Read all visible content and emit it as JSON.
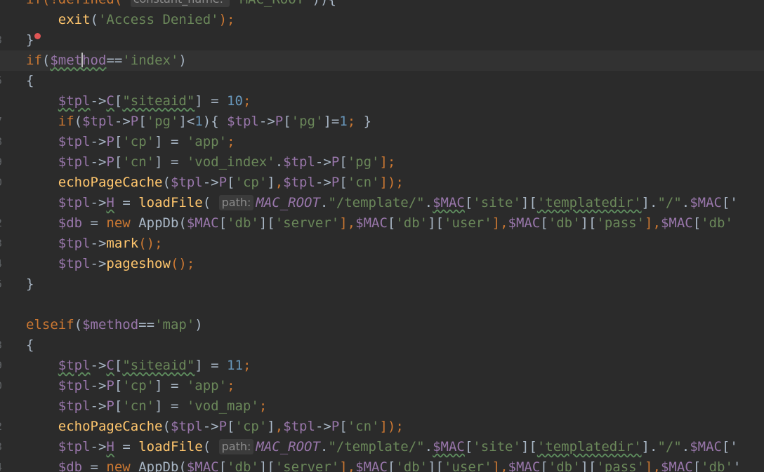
{
  "editor": {
    "line_numbers": [
      "",
      "",
      "3",
      "",
      "5",
      "",
      "7",
      "8",
      "9",
      "0",
      "",
      "2",
      "3",
      "4",
      "5",
      "",
      "",
      "3",
      "9",
      "0",
      "",
      "2",
      "3",
      "4",
      "5"
    ],
    "lines": [
      {
        "tokens": [
          {
            "t": "if(!defined( ",
            "c": "kw"
          },
          {
            "t": "constant_name: ",
            "c": "hint"
          },
          {
            "t": "'MAC_ROOT'",
            "c": "str"
          },
          {
            "t": ")){",
            "c": "op"
          }
        ]
      },
      {
        "tokens": [
          {
            "t": "    ",
            "c": ""
          },
          {
            "t": "exit",
            "c": "fn"
          },
          {
            "t": "(",
            "c": "op"
          },
          {
            "t": "'Access Denied'",
            "c": "str"
          },
          {
            "t": ");",
            "c": "kw"
          }
        ]
      },
      {
        "tokens": [
          {
            "t": "}",
            "c": "op"
          },
          {
            "t": "",
            "c": "bulb"
          }
        ]
      },
      {
        "current": true,
        "tokens": [
          {
            "t": "if",
            "c": "kw"
          },
          {
            "t": "(",
            "c": "op"
          },
          {
            "t": "$met",
            "c": "var sq"
          },
          {
            "t": "",
            "c": "caret"
          },
          {
            "t": "hod",
            "c": "var sq"
          },
          {
            "t": "==",
            "c": "op"
          },
          {
            "t": "'index'",
            "c": "str"
          },
          {
            "t": ")",
            "c": "op"
          }
        ]
      },
      {
        "tokens": [
          {
            "t": "{",
            "c": "op"
          }
        ]
      },
      {
        "tokens": [
          {
            "t": "    ",
            "c": ""
          },
          {
            "t": "$tpl",
            "c": "var sq"
          },
          {
            "t": "->",
            "c": "op"
          },
          {
            "t": "C",
            "c": "prop sq"
          },
          {
            "t": "[",
            "c": "op"
          },
          {
            "t": "\"siteaid\"",
            "c": "str sq"
          },
          {
            "t": "] = ",
            "c": "op"
          },
          {
            "t": "10",
            "c": "num"
          },
          {
            "t": ";",
            "c": "kw"
          }
        ]
      },
      {
        "tokens": [
          {
            "t": "    ",
            "c": ""
          },
          {
            "t": "if",
            "c": "kw"
          },
          {
            "t": "(",
            "c": "op"
          },
          {
            "t": "$tpl",
            "c": "var"
          },
          {
            "t": "->",
            "c": "op"
          },
          {
            "t": "P",
            "c": "prop"
          },
          {
            "t": "[",
            "c": "op"
          },
          {
            "t": "'pg'",
            "c": "str"
          },
          {
            "t": "]<",
            "c": "op"
          },
          {
            "t": "1",
            "c": "num"
          },
          {
            "t": "){ ",
            "c": "op"
          },
          {
            "t": "$tpl",
            "c": "var"
          },
          {
            "t": "->",
            "c": "op"
          },
          {
            "t": "P",
            "c": "prop"
          },
          {
            "t": "[",
            "c": "op"
          },
          {
            "t": "'pg'",
            "c": "str"
          },
          {
            "t": "]=",
            "c": "op"
          },
          {
            "t": "1",
            "c": "num"
          },
          {
            "t": "; ",
            "c": "kw"
          },
          {
            "t": "}",
            "c": "op"
          }
        ]
      },
      {
        "tokens": [
          {
            "t": "    ",
            "c": ""
          },
          {
            "t": "$tpl",
            "c": "var"
          },
          {
            "t": "->",
            "c": "op"
          },
          {
            "t": "P",
            "c": "prop"
          },
          {
            "t": "[",
            "c": "op"
          },
          {
            "t": "'cp'",
            "c": "str"
          },
          {
            "t": "] = ",
            "c": "op"
          },
          {
            "t": "'app'",
            "c": "str"
          },
          {
            "t": ";",
            "c": "kw"
          }
        ]
      },
      {
        "tokens": [
          {
            "t": "    ",
            "c": ""
          },
          {
            "t": "$tpl",
            "c": "var"
          },
          {
            "t": "->",
            "c": "op"
          },
          {
            "t": "P",
            "c": "prop"
          },
          {
            "t": "[",
            "c": "op"
          },
          {
            "t": "'cn'",
            "c": "str"
          },
          {
            "t": "] = ",
            "c": "op"
          },
          {
            "t": "'vod_index'",
            "c": "str"
          },
          {
            "t": ".",
            "c": "op"
          },
          {
            "t": "$tpl",
            "c": "var"
          },
          {
            "t": "->",
            "c": "op"
          },
          {
            "t": "P",
            "c": "prop"
          },
          {
            "t": "[",
            "c": "op"
          },
          {
            "t": "'pg'",
            "c": "str"
          },
          {
            "t": "];",
            "c": "kw"
          }
        ]
      },
      {
        "tokens": [
          {
            "t": "    ",
            "c": ""
          },
          {
            "t": "echoPageCache",
            "c": "fn"
          },
          {
            "t": "(",
            "c": "op"
          },
          {
            "t": "$tpl",
            "c": "var"
          },
          {
            "t": "->",
            "c": "op"
          },
          {
            "t": "P",
            "c": "prop"
          },
          {
            "t": "[",
            "c": "op"
          },
          {
            "t": "'cp'",
            "c": "str"
          },
          {
            "t": "]",
            "c": "op"
          },
          {
            "t": ",",
            "c": "kw"
          },
          {
            "t": "$tpl",
            "c": "var"
          },
          {
            "t": "->",
            "c": "op"
          },
          {
            "t": "P",
            "c": "prop"
          },
          {
            "t": "[",
            "c": "op"
          },
          {
            "t": "'cn'",
            "c": "str"
          },
          {
            "t": "]);",
            "c": "kw"
          }
        ]
      },
      {
        "tokens": [
          {
            "t": "    ",
            "c": ""
          },
          {
            "t": "$tpl",
            "c": "var"
          },
          {
            "t": "->",
            "c": "op"
          },
          {
            "t": "H",
            "c": "prop sq"
          },
          {
            "t": " = ",
            "c": "op"
          },
          {
            "t": "loadFile",
            "c": "fn"
          },
          {
            "t": "( ",
            "c": "op"
          },
          {
            "t": "path:",
            "c": "hint"
          },
          {
            "t": "MAC_ROOT",
            "c": "const"
          },
          {
            "t": ".",
            "c": "op"
          },
          {
            "t": "\"/template/\"",
            "c": "str"
          },
          {
            "t": ".",
            "c": "op"
          },
          {
            "t": "$MAC",
            "c": "var sq"
          },
          {
            "t": "[",
            "c": "op"
          },
          {
            "t": "'site'",
            "c": "str"
          },
          {
            "t": "][",
            "c": "op"
          },
          {
            "t": "'templatedir'",
            "c": "str sq"
          },
          {
            "t": "].",
            "c": "op"
          },
          {
            "t": "\"/\"",
            "c": "str"
          },
          {
            "t": ".",
            "c": "op"
          },
          {
            "t": "$MAC",
            "c": "var"
          },
          {
            "t": "['",
            "c": "op"
          }
        ]
      },
      {
        "tokens": [
          {
            "t": "    ",
            "c": ""
          },
          {
            "t": "$db",
            "c": "var"
          },
          {
            "t": " = ",
            "c": "op"
          },
          {
            "t": "new ",
            "c": "kw"
          },
          {
            "t": "AppDb",
            "c": "cls"
          },
          {
            "t": "(",
            "c": "op"
          },
          {
            "t": "$MAC",
            "c": "var"
          },
          {
            "t": "[",
            "c": "op"
          },
          {
            "t": "'db'",
            "c": "str"
          },
          {
            "t": "][",
            "c": "op"
          },
          {
            "t": "'server'",
            "c": "str"
          },
          {
            "t": "],",
            "c": "kw"
          },
          {
            "t": "$MAC",
            "c": "var"
          },
          {
            "t": "[",
            "c": "op"
          },
          {
            "t": "'db'",
            "c": "str"
          },
          {
            "t": "][",
            "c": "op"
          },
          {
            "t": "'user'",
            "c": "str"
          },
          {
            "t": "],",
            "c": "kw"
          },
          {
            "t": "$MAC",
            "c": "var"
          },
          {
            "t": "[",
            "c": "op"
          },
          {
            "t": "'db'",
            "c": "str"
          },
          {
            "t": "][",
            "c": "op"
          },
          {
            "t": "'pass'",
            "c": "str"
          },
          {
            "t": "],",
            "c": "kw"
          },
          {
            "t": "$MAC",
            "c": "var"
          },
          {
            "t": "[",
            "c": "op"
          },
          {
            "t": "'db'",
            "c": "str"
          }
        ]
      },
      {
        "tokens": [
          {
            "t": "    ",
            "c": ""
          },
          {
            "t": "$tpl",
            "c": "var"
          },
          {
            "t": "->",
            "c": "op"
          },
          {
            "t": "mark",
            "c": "fn"
          },
          {
            "t": "();",
            "c": "kw"
          }
        ]
      },
      {
        "tokens": [
          {
            "t": "    ",
            "c": ""
          },
          {
            "t": "$tpl",
            "c": "var"
          },
          {
            "t": "->",
            "c": "op"
          },
          {
            "t": "pageshow",
            "c": "fn"
          },
          {
            "t": "();",
            "c": "kw"
          }
        ]
      },
      {
        "tokens": [
          {
            "t": "}",
            "c": "op"
          }
        ]
      },
      {
        "tokens": []
      },
      {
        "tokens": [
          {
            "t": "elseif",
            "c": "kw"
          },
          {
            "t": "(",
            "c": "op"
          },
          {
            "t": "$method",
            "c": "var"
          },
          {
            "t": "==",
            "c": "op"
          },
          {
            "t": "'map'",
            "c": "str"
          },
          {
            "t": ")",
            "c": "op"
          }
        ]
      },
      {
        "tokens": [
          {
            "t": "{",
            "c": "op"
          }
        ]
      },
      {
        "tokens": [
          {
            "t": "    ",
            "c": ""
          },
          {
            "t": "$tpl",
            "c": "var sq"
          },
          {
            "t": "->",
            "c": "op"
          },
          {
            "t": "C",
            "c": "prop sq"
          },
          {
            "t": "[",
            "c": "op"
          },
          {
            "t": "\"siteaid\"",
            "c": "str sq"
          },
          {
            "t": "] = ",
            "c": "op"
          },
          {
            "t": "11",
            "c": "num"
          },
          {
            "t": ";",
            "c": "kw"
          }
        ]
      },
      {
        "tokens": [
          {
            "t": "    ",
            "c": ""
          },
          {
            "t": "$tpl",
            "c": "var"
          },
          {
            "t": "->",
            "c": "op"
          },
          {
            "t": "P",
            "c": "prop"
          },
          {
            "t": "[",
            "c": "op"
          },
          {
            "t": "'cp'",
            "c": "str"
          },
          {
            "t": "] = ",
            "c": "op"
          },
          {
            "t": "'app'",
            "c": "str"
          },
          {
            "t": ";",
            "c": "kw"
          }
        ]
      },
      {
        "tokens": [
          {
            "t": "    ",
            "c": ""
          },
          {
            "t": "$tpl",
            "c": "var"
          },
          {
            "t": "->",
            "c": "op"
          },
          {
            "t": "P",
            "c": "prop"
          },
          {
            "t": "[",
            "c": "op"
          },
          {
            "t": "'cn'",
            "c": "str"
          },
          {
            "t": "] = ",
            "c": "op"
          },
          {
            "t": "'vod_map'",
            "c": "str"
          },
          {
            "t": ";",
            "c": "kw"
          }
        ]
      },
      {
        "tokens": [
          {
            "t": "    ",
            "c": ""
          },
          {
            "t": "echoPageCache",
            "c": "fn"
          },
          {
            "t": "(",
            "c": "op"
          },
          {
            "t": "$tpl",
            "c": "var"
          },
          {
            "t": "->",
            "c": "op"
          },
          {
            "t": "P",
            "c": "prop"
          },
          {
            "t": "[",
            "c": "op"
          },
          {
            "t": "'cp'",
            "c": "str"
          },
          {
            "t": "]",
            "c": "op"
          },
          {
            "t": ",",
            "c": "kw"
          },
          {
            "t": "$tpl",
            "c": "var"
          },
          {
            "t": "->",
            "c": "op"
          },
          {
            "t": "P",
            "c": "prop"
          },
          {
            "t": "[",
            "c": "op"
          },
          {
            "t": "'cn'",
            "c": "str"
          },
          {
            "t": "]);",
            "c": "kw"
          }
        ]
      },
      {
        "tokens": [
          {
            "t": "    ",
            "c": ""
          },
          {
            "t": "$tpl",
            "c": "var"
          },
          {
            "t": "->",
            "c": "op"
          },
          {
            "t": "H",
            "c": "prop sq"
          },
          {
            "t": " = ",
            "c": "op"
          },
          {
            "t": "loadFile",
            "c": "fn"
          },
          {
            "t": "( ",
            "c": "op"
          },
          {
            "t": "path:",
            "c": "hint"
          },
          {
            "t": "MAC_ROOT",
            "c": "const"
          },
          {
            "t": ".",
            "c": "op"
          },
          {
            "t": "\"/template/\"",
            "c": "str"
          },
          {
            "t": ".",
            "c": "op"
          },
          {
            "t": "$MAC",
            "c": "var sq"
          },
          {
            "t": "[",
            "c": "op"
          },
          {
            "t": "'site'",
            "c": "str"
          },
          {
            "t": "][",
            "c": "op"
          },
          {
            "t": "'templatedir'",
            "c": "str sq"
          },
          {
            "t": "].",
            "c": "op"
          },
          {
            "t": "\"/\"",
            "c": "str"
          },
          {
            "t": ".",
            "c": "op"
          },
          {
            "t": "$MAC",
            "c": "var"
          },
          {
            "t": "['",
            "c": "op"
          }
        ]
      },
      {
        "tokens": [
          {
            "t": "    ",
            "c": ""
          },
          {
            "t": "$db",
            "c": "var"
          },
          {
            "t": " = ",
            "c": "op"
          },
          {
            "t": "new ",
            "c": "kw"
          },
          {
            "t": "AppDb",
            "c": "cls"
          },
          {
            "t": "(",
            "c": "op"
          },
          {
            "t": "$MAC",
            "c": "var"
          },
          {
            "t": "[",
            "c": "op"
          },
          {
            "t": "'db'",
            "c": "str"
          },
          {
            "t": "][",
            "c": "op"
          },
          {
            "t": "'server'",
            "c": "str"
          },
          {
            "t": "],",
            "c": "kw"
          },
          {
            "t": "$MAC",
            "c": "var"
          },
          {
            "t": "[",
            "c": "op"
          },
          {
            "t": "'db'",
            "c": "str"
          },
          {
            "t": "][",
            "c": "op"
          },
          {
            "t": "'user'",
            "c": "str"
          },
          {
            "t": "],",
            "c": "kw"
          },
          {
            "t": "$MAC",
            "c": "var"
          },
          {
            "t": "[",
            "c": "op"
          },
          {
            "t": "'db'",
            "c": "str"
          },
          {
            "t": "][",
            "c": "op"
          },
          {
            "t": "'pass'",
            "c": "str"
          },
          {
            "t": "],",
            "c": "kw"
          },
          {
            "t": "$MAC",
            "c": "var"
          },
          {
            "t": "[",
            "c": "op"
          },
          {
            "t": "'db'",
            "c": "str"
          },
          {
            "t": "'",
            "c": "op"
          }
        ]
      }
    ]
  }
}
